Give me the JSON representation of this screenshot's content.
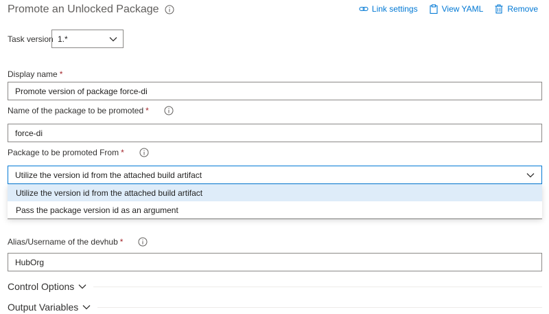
{
  "header": {
    "title": "Promote an Unlocked Package",
    "actions": {
      "link_settings": "Link settings",
      "view_yaml": "View YAML",
      "remove": "Remove"
    }
  },
  "task_version": {
    "label": "Task version",
    "value": "1.*"
  },
  "fields": {
    "display_name": {
      "label": "Display name",
      "required": "*",
      "value": "Promote version of package force-di"
    },
    "package_name": {
      "label": "Name of the package to be promoted",
      "required": "*",
      "value": "force-di"
    },
    "promoted_from": {
      "label": "Package to be promoted From",
      "required": "*",
      "value": "Utilize the version id from the attached build artifact",
      "options": [
        "Utilize the version id from the attached build artifact",
        "Pass the package version id as an argument"
      ]
    },
    "devhub_alias": {
      "label": "Alias/Username of the devhub",
      "required": "*",
      "value": "HubOrg"
    }
  },
  "sections": {
    "control_options": "Control Options",
    "output_variables": "Output Variables"
  },
  "colors": {
    "accent": "#0078d4",
    "required": "#a4262c",
    "selected_option_bg": "#deecf9"
  }
}
